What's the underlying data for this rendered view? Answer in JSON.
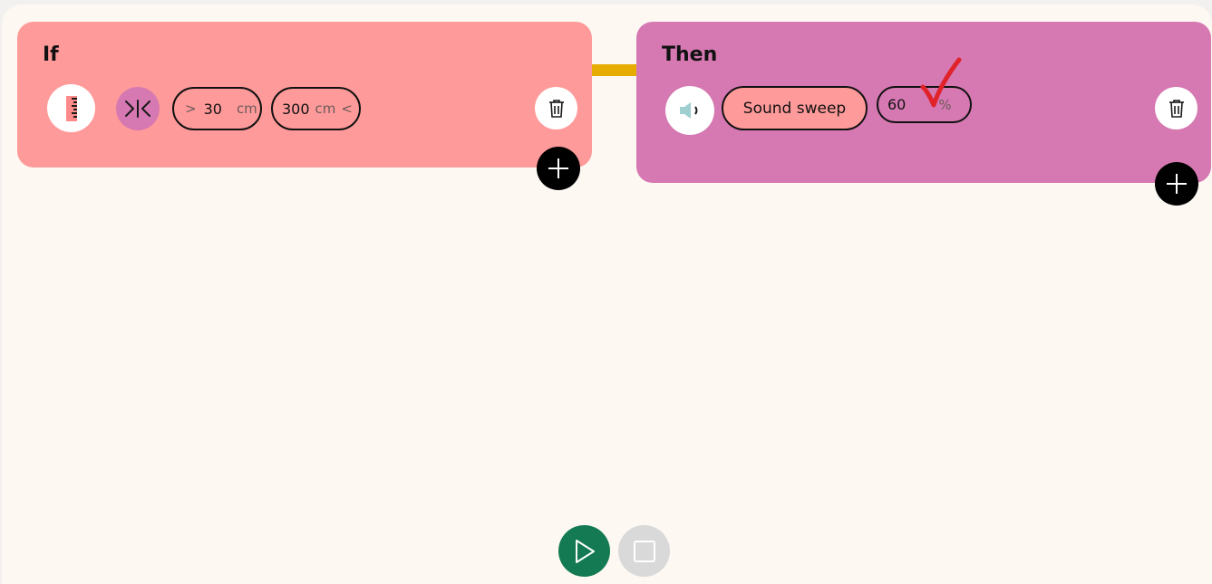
{
  "colors": {
    "if_block": "#ff9a9a",
    "then_block": "#d678b2",
    "connector": "#e6ac00",
    "play_button": "#137a53",
    "stop_button": "#d9d9d9",
    "annotation_check": "#e0222a"
  },
  "if_block": {
    "title": "If",
    "sensor_icon": "distance-sensor-icon",
    "mode_icon": "between-range-icon",
    "min_prefix": ">",
    "min_value": "30",
    "min_unit": "cm",
    "max_value": "300",
    "max_unit": "cm",
    "max_suffix": "<",
    "delete_icon": "trash-icon",
    "add_icon": "plus-icon"
  },
  "then_block": {
    "title": "Then",
    "action_icon": "speaker-icon",
    "action_label": "Sound sweep",
    "volume_value": "60",
    "volume_unit": "%",
    "delete_icon": "trash-icon",
    "add_icon": "plus-icon"
  },
  "controls": {
    "play_icon": "play-icon",
    "stop_icon": "stop-icon"
  }
}
